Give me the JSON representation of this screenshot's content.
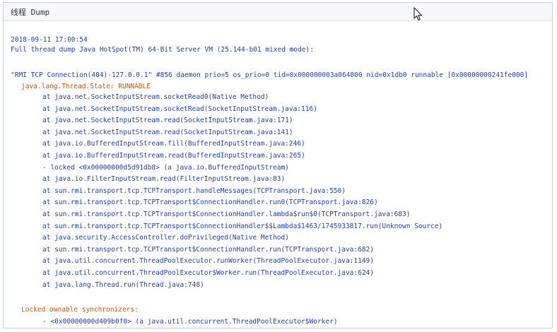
{
  "panel": {
    "title": "线程 Dump"
  },
  "dump": {
    "timestamp": "2018-09-11 17:00:54",
    "header": "Full thread dump Java HotSpot(TM) 64-Bit Server VM (25.144-b01 mixed mode):",
    "thread_line": "\"RMI TCP Connection(404)-127.0.0.1\" #856 daemon prio=5 os_prio=0 tid=0x000000003a064800 nid=0x1db0 runnable [0x00000000241fe000]",
    "thread_state": "java.lang.Thread.State: RUNNABLE",
    "frames": [
      "at java.net.SocketInputStream.socketRead0(Native Method)",
      "at java.net.SocketInputStream.socketRead(SocketInputStream.java:116)",
      "at java.net.SocketInputStream.read(SocketInputStream.java:171)",
      "at java.net.SocketInputStream.read(SocketInputStream.java:141)",
      "at java.io.BufferedInputStream.fill(BufferedInputStream.java:246)",
      "at java.io.BufferedInputStream.read(BufferedInputStream.java:265)",
      "- locked <0x00000000d5d91db8> (a java.io.BufferedInputStream)",
      "at java.io.FilterInputStream.read(FilterInputStream.java:83)",
      "at sun.rmi.transport.tcp.TCPTransport.handleMessages(TCPTransport.java:550)",
      "at sun.rmi.transport.tcp.TCPTransport$ConnectionHandler.run0(TCPTransport.java:826)",
      "at sun.rmi.transport.tcp.TCPTransport$ConnectionHandler.lambda$run$0(TCPTransport.java:683)",
      "at sun.rmi.transport.tcp.TCPTransport$ConnectionHandler$$Lambda$1463/1745933817.run(Unknown Source)",
      "at java.security.AccessController.doPrivileged(Native Method)",
      "at sun.rmi.transport.tcp.TCPTransport$ConnectionHandler.run(TCPTransport.java:682)",
      "at java.util.concurrent.ThreadPoolExecutor.runWorker(ThreadPoolExecutor.java:1149)",
      "at java.util.concurrent.ThreadPoolExecutor$Worker.run(ThreadPoolExecutor.java:624)",
      "at java.lang.Thread.run(Thread.java:748)"
    ],
    "synchronizers_label": "Locked ownable synchronizers:",
    "synchronizers": [
      "- <0x00000000d409b0f0> (a java.util.concurrent.ThreadPoolExecutor$Worker)"
    ]
  },
  "icons": {
    "cursor": "mouse-pointer-icon"
  },
  "colors": {
    "text_blue": "#1f3fbf",
    "text_orange": "#c55a11"
  }
}
